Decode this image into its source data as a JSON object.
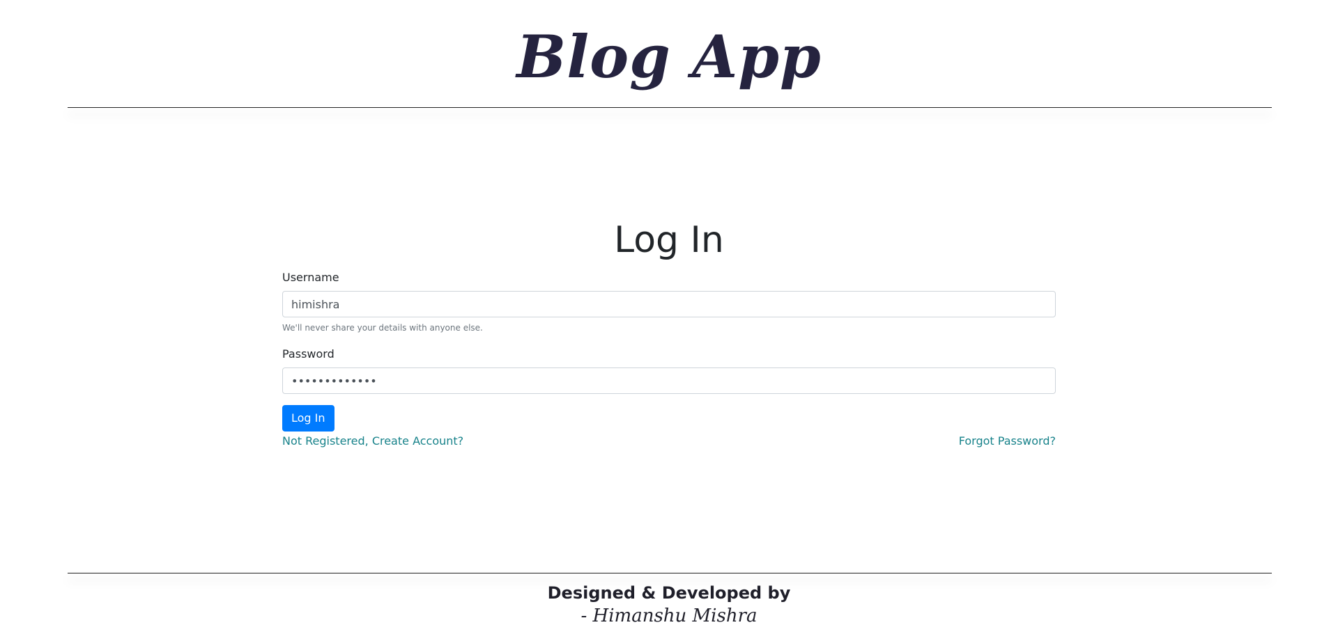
{
  "header": {
    "brand": "Blog App"
  },
  "login": {
    "title": "Log In",
    "username_label": "Username",
    "username_value": "himishra",
    "username_help": "We'll never share your details with anyone else.",
    "password_label": "Password",
    "password_value": "•••••••••••••",
    "submit_label": "Log In",
    "register_link": "Not Registered, Create Account?",
    "forgot_link": "Forgot Password?"
  },
  "footer": {
    "line1": "Designed & Developed by",
    "line2": "- Himanshu Mishra"
  },
  "colors": {
    "brand": "#25233f",
    "primary_button": "#007bff",
    "link": "#17828a"
  }
}
